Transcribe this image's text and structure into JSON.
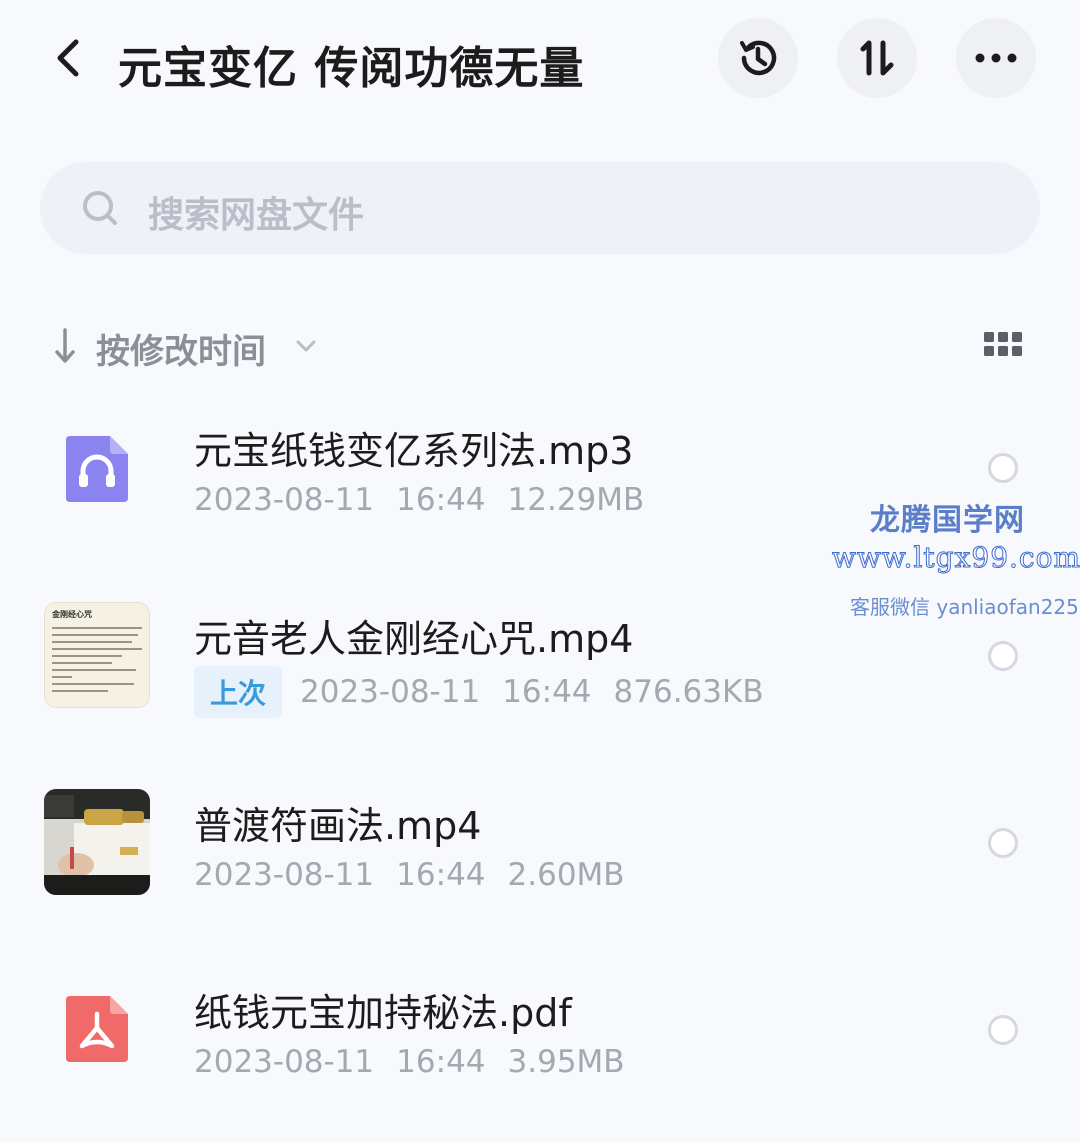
{
  "header": {
    "title": "元宝变亿 传阅功德无量",
    "back_icon": "chevron-left-icon",
    "history_icon": "history-icon",
    "sort_icon": "sort-order-icon",
    "more_icon": "more-dots-icon"
  },
  "search": {
    "placeholder": "搜索网盘文件",
    "icon": "search-icon"
  },
  "sortbar": {
    "label": "按修改时间",
    "arrow_icon": "arrow-down-icon",
    "chevron_icon": "chevron-down-icon",
    "view_icon": "grid-view-icon"
  },
  "files": [
    {
      "name": "元宝纸钱变亿系列法.mp3",
      "date": "2023-08-11",
      "time": "16:44",
      "size": "12.29MB",
      "icon": "audio-file-icon",
      "badge": ""
    },
    {
      "name": "元音老人金刚经心咒.mp4",
      "date": "2023-08-11",
      "time": "16:44",
      "size": "876.63KB",
      "icon": "video-thumbnail",
      "badge": "上次",
      "thumb_title": "金刚经心咒"
    },
    {
      "name": "普渡符画法.mp4",
      "date": "2023-08-11",
      "time": "16:44",
      "size": "2.60MB",
      "icon": "video-thumbnail",
      "badge": ""
    },
    {
      "name": "纸钱元宝加持秘法.pdf",
      "date": "2023-08-11",
      "time": "16:44",
      "size": "3.95MB",
      "icon": "pdf-file-icon",
      "badge": ""
    }
  ],
  "watermark": {
    "title": "龙腾国学网",
    "url": "www.ltgx99.com",
    "contact": "客服微信 yanliaofan225"
  },
  "colors": {
    "audio_icon": "#8a83f0",
    "pdf_icon": "#f06a6a",
    "badge_text": "#3a9bdc",
    "watermark": "#4a72cc"
  }
}
